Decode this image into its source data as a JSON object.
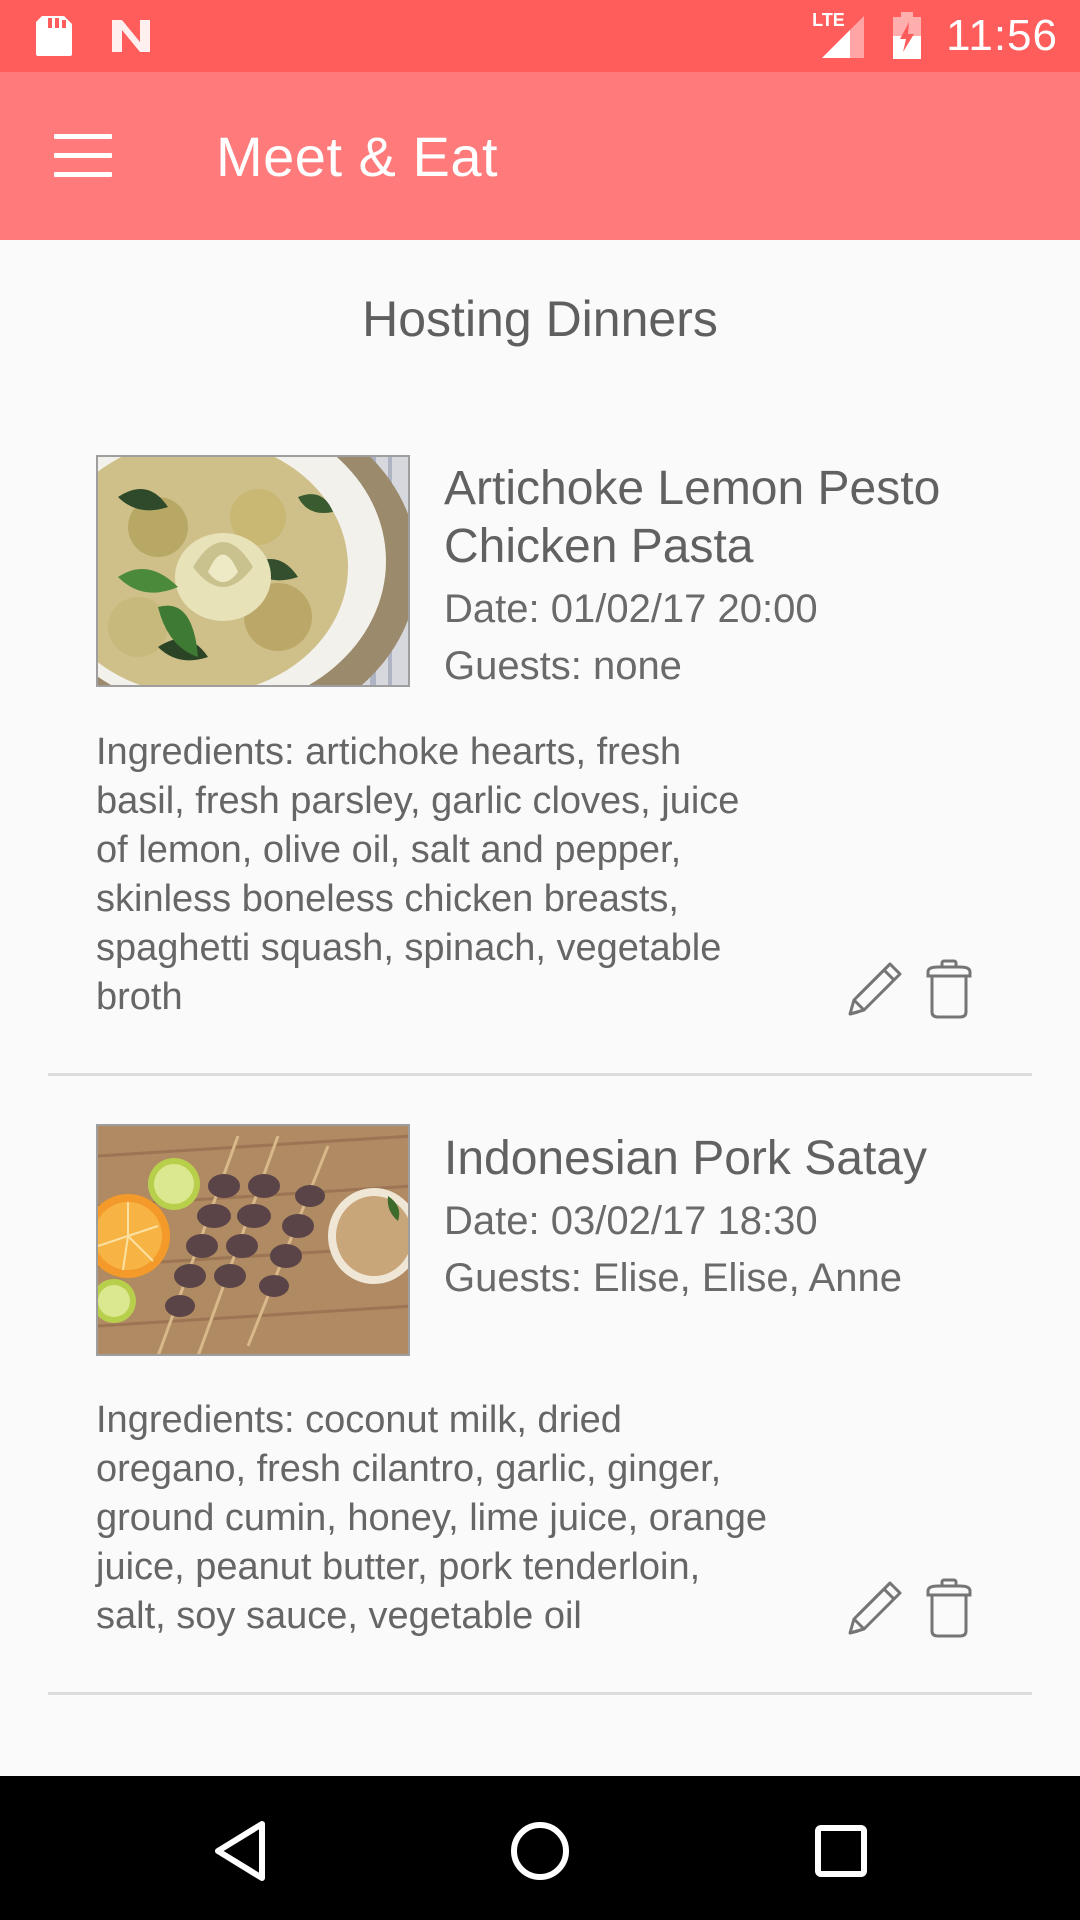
{
  "status_bar": {
    "time": "11:56",
    "network_label": "LTE",
    "icons": [
      "sd-card-icon",
      "n-logo-icon",
      "signal-icon",
      "battery-icon"
    ]
  },
  "app_bar": {
    "title": "Meet & Eat",
    "menu_icon": "hamburger-menu-icon",
    "background": "#ff7b7b"
  },
  "page": {
    "heading": "Hosting Dinners"
  },
  "dinners": [
    {
      "title_line1": "Artichoke Lemon Pesto",
      "title_line2": "Chicken Pasta",
      "date": "Date: 01/02/17 20:00",
      "guests": "Guests: none",
      "ingredients_lines": [
        "Ingredients: artichoke hearts, fresh",
        "basil, fresh parsley, garlic cloves, juice",
        "of lemon, olive oil, salt and pepper,",
        "skinless boneless chicken breasts,",
        "spaghetti squash, spinach, vegetable",
        "broth"
      ],
      "image_icon": "pasta-dish-photo"
    },
    {
      "title_line1": "Indonesian Pork Satay",
      "date": "Date: 03/02/17 18:30",
      "guests": "Guests: Elise, Elise, Anne",
      "ingredients_lines": [
        "Ingredients: coconut milk, dried",
        "oregano, fresh cilantro, garlic, ginger,",
        "ground cumin, honey, lime juice, orange",
        "juice, peanut butter, pork tenderloin,",
        "salt, soy sauce, vegetable oil"
      ],
      "image_icon": "satay-skewers-photo"
    }
  ],
  "nav_bar": {
    "icons": [
      "back-icon",
      "home-icon",
      "recents-icon"
    ]
  }
}
